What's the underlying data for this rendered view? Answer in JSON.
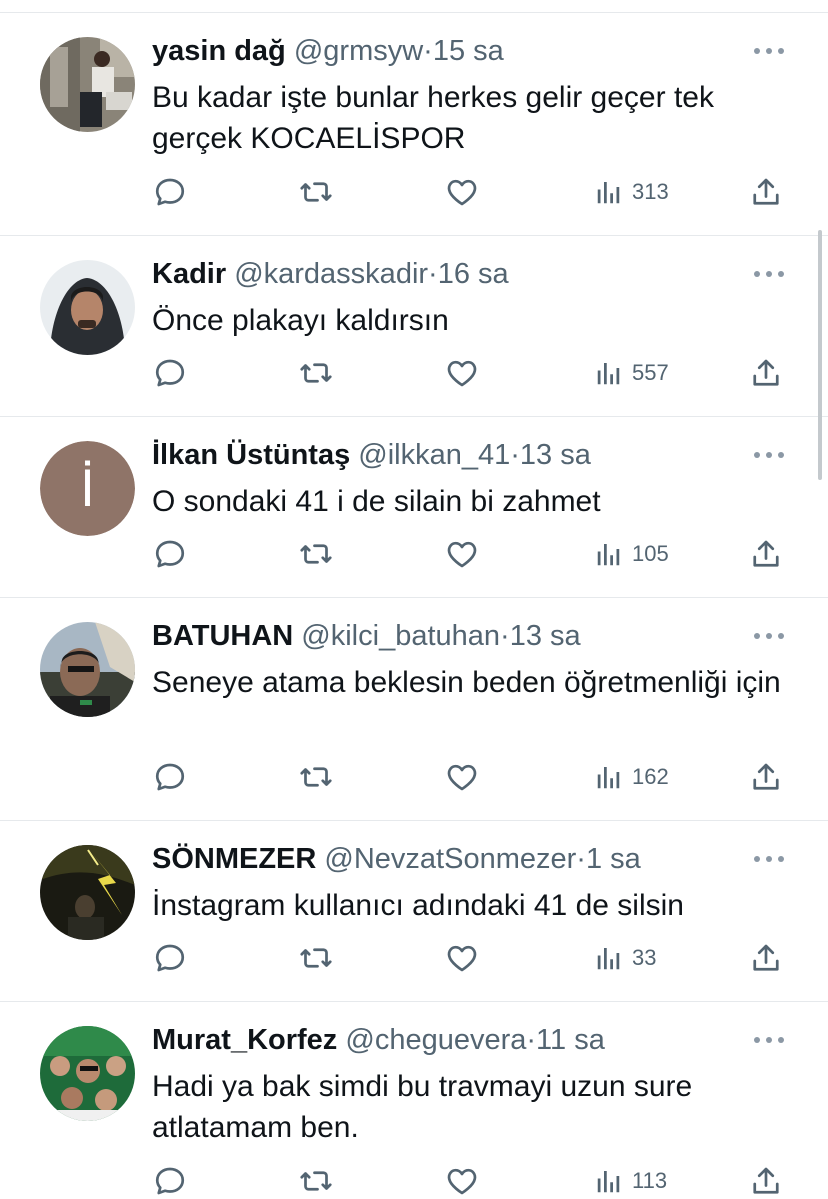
{
  "colors": {
    "text": "#0f1419",
    "secondary": "#536471",
    "divider": "#e6e9ec",
    "icon": "#536471"
  },
  "tweets": [
    {
      "name": "yasin dağ",
      "handle": "@grmsyw",
      "sep": "·",
      "time": "15 sa",
      "text": "Bu kadar işte bunlar herkes gelir geçer tek gerçek KOCAELİSPOR",
      "views": "313",
      "avatar": "photo-person-standing"
    },
    {
      "name": "Kadir",
      "handle": "@kardasskadir",
      "sep": "·",
      "time": "16 sa",
      "text": "Önce plakayı kaldırsın",
      "views": "557",
      "avatar": "photo-person-hoodie"
    },
    {
      "name": "İlkan Üstüntaş",
      "handle": "@ilkkan_41",
      "sep": "·",
      "time": "13 sa",
      "text": "O sondaki 41 i de silain bi zahmet",
      "views": "105",
      "avatar_letter": "İ"
    },
    {
      "name": "BATUHAN",
      "handle": "@kilci_batuhan",
      "sep": "·",
      "time": "13 sa",
      "text": "Seneye atama beklesin beden öğretmenliği için",
      "views": "162",
      "avatar": "photo-person-selfie"
    },
    {
      "name": "SÖNMEZER",
      "handle": "@NevzatSonmezer",
      "sep": "·",
      "time": "1 sa",
      "text": "İnstagram kullanıcı adındaki 41 de silsin",
      "views": "33",
      "avatar": "photo-dark-lightning"
    },
    {
      "name": "Murat_Korfez",
      "handle": "@cheguevera",
      "sep": "·",
      "time": "11 sa",
      "text": "Hadi ya bak simdi bu travmayi uzun sure atlatamam ben.",
      "views": "113",
      "avatar": "photo-crowd-green"
    }
  ]
}
